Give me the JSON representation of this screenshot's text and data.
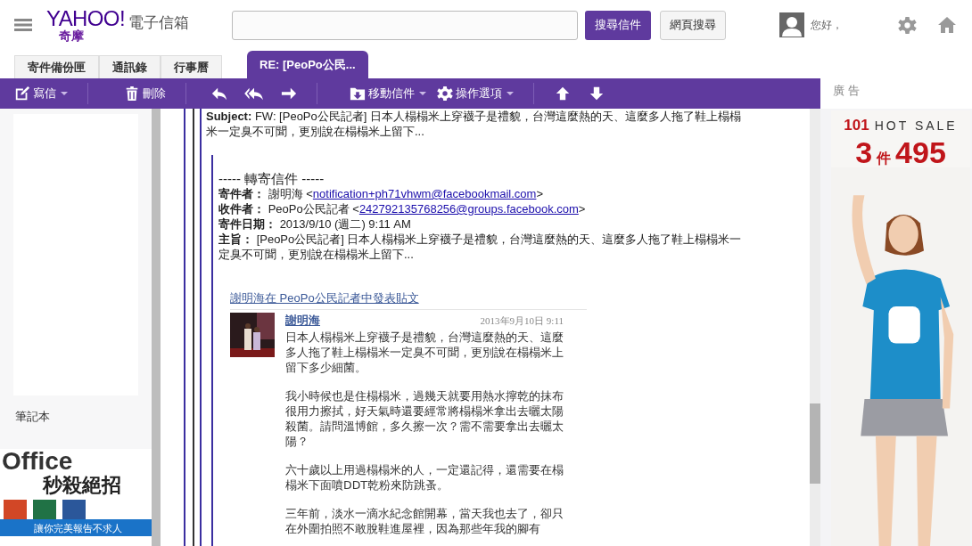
{
  "header": {
    "logo": "YAHOO!",
    "logo_sub": "奇摩",
    "product": "電子信箱",
    "search_mail": "搜尋信件",
    "search_web": "網頁搜尋",
    "greeting": "您好，"
  },
  "tabs": [
    {
      "label": "寄件備份匣",
      "selected": false
    },
    {
      "label": "通訊錄",
      "selected": false
    },
    {
      "label": "行事曆",
      "selected": false
    },
    {
      "label": "RE: [PeoPo公民...",
      "selected": true
    }
  ],
  "toolbar": [
    {
      "kind": "compose",
      "label": "寫信",
      "menu": true
    },
    {
      "kind": "delete",
      "label": "刪除",
      "menu": false
    },
    {
      "kind": "reply",
      "menu": false
    },
    {
      "kind": "reply-all",
      "menu": false
    },
    {
      "kind": "forward",
      "menu": false
    },
    {
      "kind": "move",
      "label": "移動信件",
      "menu": true
    },
    {
      "kind": "actions",
      "label": "操作選項",
      "menu": true
    },
    {
      "kind": "up",
      "menu": false
    },
    {
      "kind": "down",
      "menu": false
    }
  ],
  "sidebar": {
    "items": [
      "筆記本"
    ],
    "ad": {
      "title": "Office",
      "subtitle": "秒殺絕招",
      "tagline": "讓你完美報告不求人"
    }
  },
  "message": {
    "subject_label": "Subject:",
    "subject": "FW: [PeoPo公民記者] 日本人榻榻米上穿襪子是禮貌，台灣這麼熱的天、這麼多人拖了鞋上榻榻米一定臭不可聞，更別說在榻榻米上留下...",
    "forward_title": "----- 轉寄信件 -----",
    "fields": [
      {
        "label": "寄件者：",
        "value": "謝明海 <",
        "link": "notification+ph71vhwm@facebookmail.com",
        "tail": ">"
      },
      {
        "label": "收件者：",
        "value": "PeoPo公民記者 <",
        "link": "242792135768256@groups.facebook.com",
        "tail": ">"
      },
      {
        "label": "寄件日期：",
        "value": "2013/9/10 (週二) 9:11 AM"
      },
      {
        "label": "主旨：",
        "value": "[PeoPo公民記者] 日本人榻榻米上穿襪子是禮貌，台灣這麼熱的天、這麼多人拖了鞋上榻榻米一定臭不可聞，更別說在榻榻米上留下..."
      }
    ],
    "post": {
      "heading": "謝明海在 PeoPo公民記者中發表貼文",
      "author": "謝明海",
      "date": "2013年9月10日 9:11",
      "paragraphs": [
        "日本人榻榻米上穿襪子是禮貌，台灣這麼熱的天、這麼多人拖了鞋上榻榻米一定臭不可聞，更別說在榻榻米上留下多少細菌。",
        "我小時候也是住榻榻米，過幾天就要用熱水擰乾的抹布很用力擦拭，好天氣時還要經常將榻榻米拿出去曬太陽殺菌。請問溫博館，多久擦一次？需不需要拿出去曬太陽？",
        "六十歲以上用過榻榻米的人，一定還記得，還需要在榻榻米下面噴DDT乾粉來防跳蚤。",
        "三年前，淡水一滴水紀念館開幕，當天我也去了，卻只在外圍拍照不敢脫鞋進屋裡，因為那些年我的腳有"
      ]
    }
  },
  "ad": {
    "label": "廣 告",
    "brand": "101",
    "headline": "HOT SALE",
    "price_qty": "3",
    "price_unit": "件",
    "price": "495"
  }
}
